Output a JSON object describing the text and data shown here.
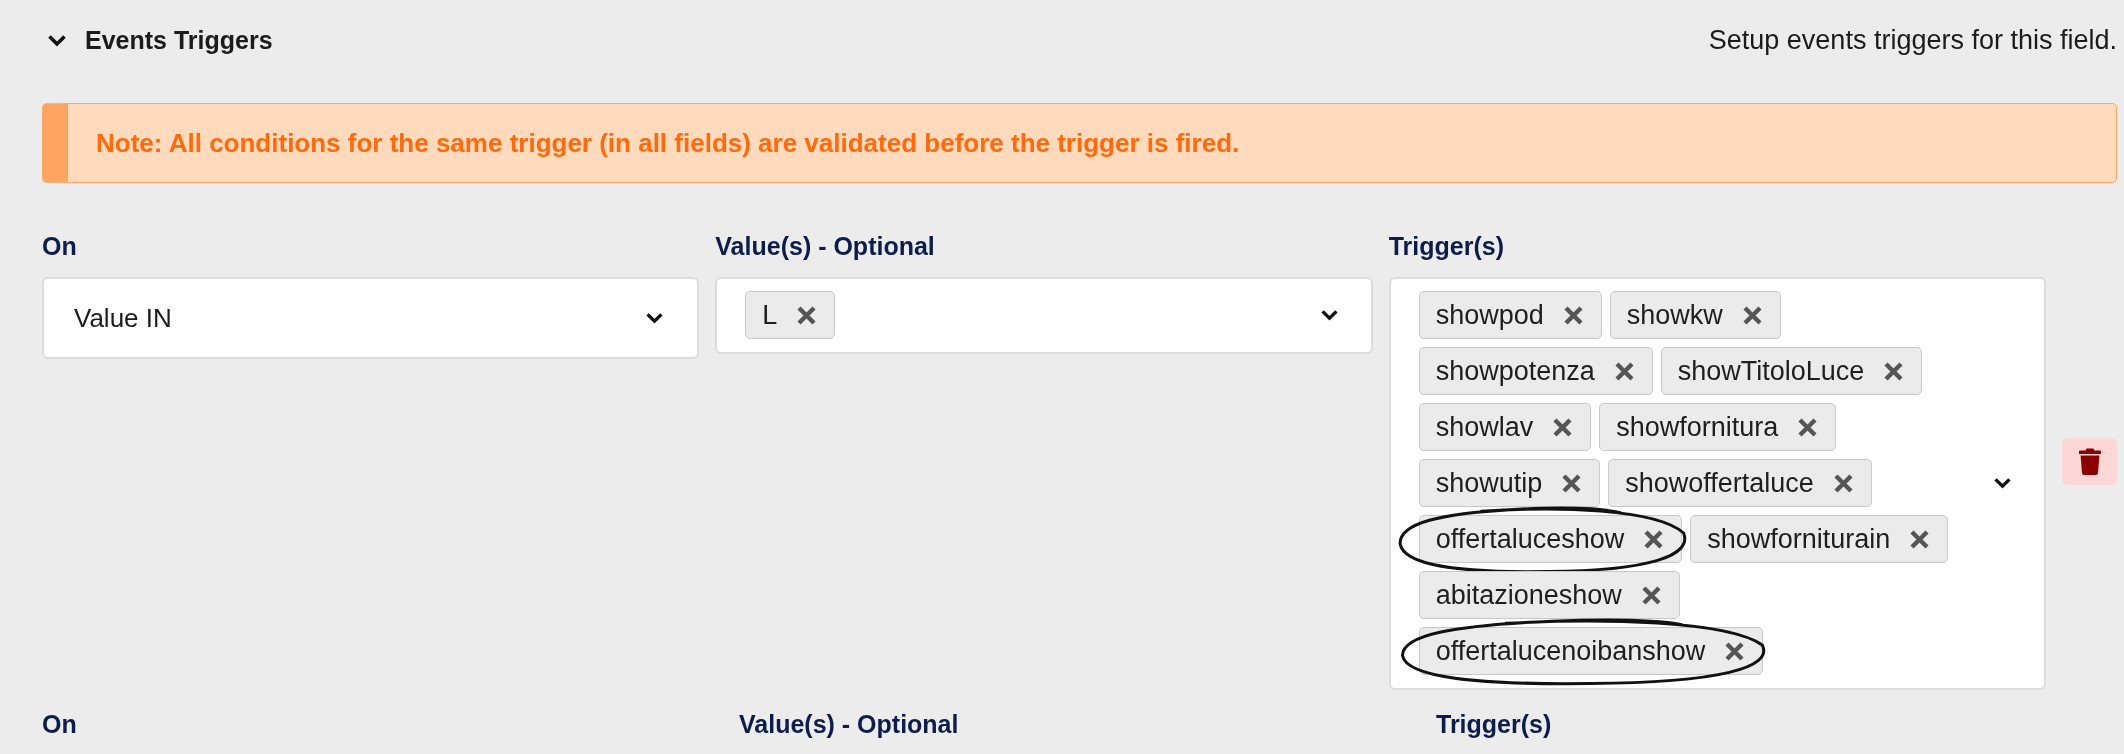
{
  "section": {
    "title": "Events Triggers",
    "expanded": true,
    "description": "Setup events triggers for this field."
  },
  "note": {
    "text": "Note: All conditions for the same trigger (in all fields) are validated before the trigger is fired."
  },
  "rules": [
    {
      "on": {
        "label": "On",
        "value": "Value IN"
      },
      "values": {
        "label": "Value(s) - Optional",
        "tags": [
          {
            "text": "L",
            "circled": false
          }
        ]
      },
      "triggers": {
        "label": "Trigger(s)",
        "tags": [
          {
            "text": "showpod",
            "circled": false
          },
          {
            "text": "showkw",
            "circled": false
          },
          {
            "text": "showpotenza",
            "circled": false
          },
          {
            "text": "showTitoloLuce",
            "circled": false
          },
          {
            "text": "showlav",
            "circled": false
          },
          {
            "text": "showfornitura",
            "circled": false
          },
          {
            "text": "showutip",
            "circled": false
          },
          {
            "text": "showoffertaluce",
            "circled": false
          },
          {
            "text": "offertaluceshow",
            "circled": true
          },
          {
            "text": "showforniturain",
            "circled": false
          },
          {
            "text": "abitazioneshow",
            "circled": false
          },
          {
            "text": "offertalucenoibanshow",
            "circled": true
          }
        ]
      }
    },
    {
      "on": {
        "label": "On"
      },
      "values": {
        "label": "Value(s) - Optional"
      },
      "triggers": {
        "label": "Trigger(s)"
      }
    }
  ]
}
